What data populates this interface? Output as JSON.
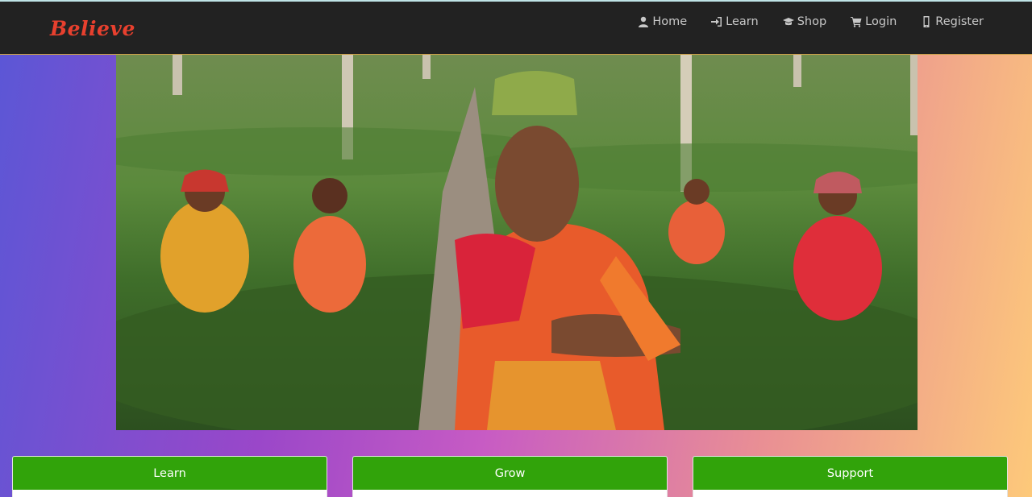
{
  "app": {
    "brand": "Believe"
  },
  "nav": {
    "items": [
      {
        "label": "Home",
        "icon": "user-icon"
      },
      {
        "label": "Learn",
        "icon": "sign-in-icon"
      },
      {
        "label": "Shop",
        "icon": "graduation-cap-icon"
      },
      {
        "label": "Login",
        "icon": "cart-icon"
      },
      {
        "label": "Register",
        "icon": "mobile-icon"
      }
    ]
  },
  "cards": [
    {
      "title": "Learn"
    },
    {
      "title": "Grow"
    },
    {
      "title": "Support"
    }
  ],
  "colors": {
    "brand": "#e8402e",
    "navbar": "#222222",
    "card_header": "#31a30a"
  }
}
